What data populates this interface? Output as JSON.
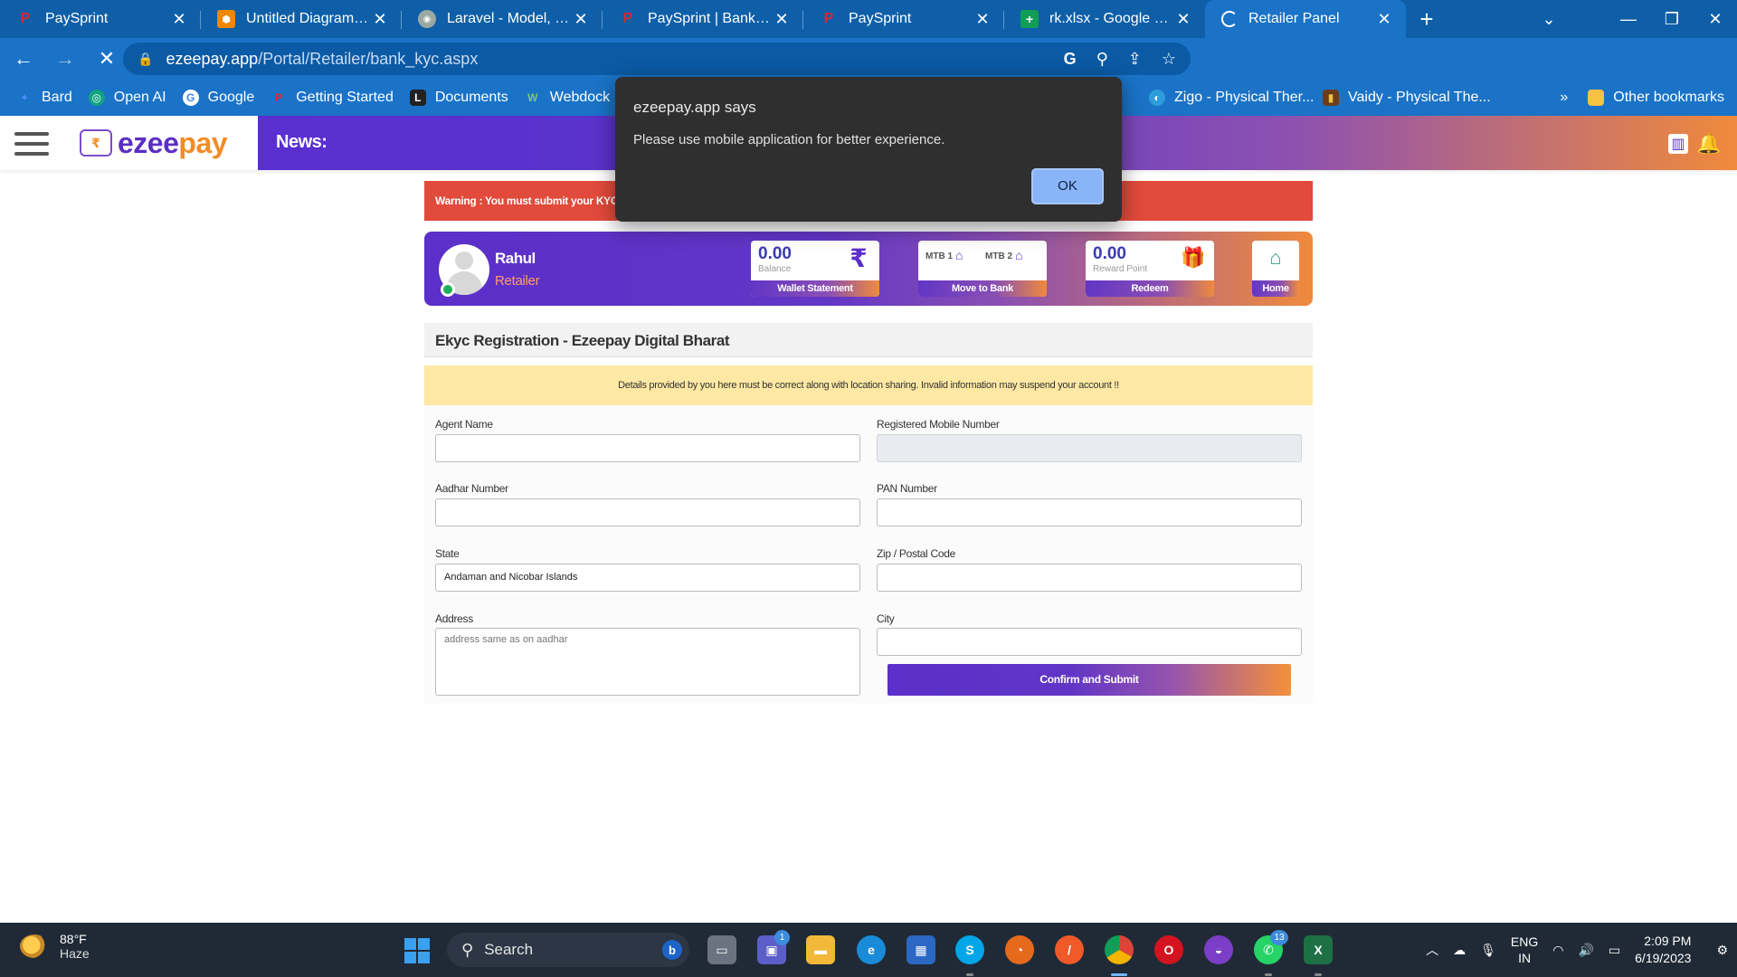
{
  "browser": {
    "tabs": [
      {
        "title": "PaySprint",
        "icon": "paysprint-icon",
        "color": "#e0232e"
      },
      {
        "title": "Untitled Diagram - draw.io",
        "icon": "drawio-icon",
        "color": "#f08705"
      },
      {
        "title": "Laravel - Model, Controller",
        "icon": "laravel-icon",
        "color": "#9aa9a1"
      },
      {
        "title": "PaySprint | Banking, Fintech",
        "icon": "paysprint-icon",
        "color": "#e0232e"
      },
      {
        "title": "PaySprint",
        "icon": "paysprint-icon",
        "color": "#e0232e"
      },
      {
        "title": "rk.xlsx - Google Sheets",
        "icon": "sheets-icon",
        "color": "#0f9d58"
      },
      {
        "title": "Retailer Panel",
        "icon": "loading-icon",
        "color": "#ffffff"
      }
    ],
    "url_host": "ezeepay.app",
    "url_path": "/Portal/Retailer/bank_kyc.aspx",
    "bookmarks": [
      {
        "label": "Bard",
        "color": "#4c8df6"
      },
      {
        "label": "Open AI",
        "color": "#10a37f"
      },
      {
        "label": "Google",
        "color": "#ffffff"
      },
      {
        "label": "Getting Started",
        "color": "#e0232e"
      },
      {
        "label": "Documents",
        "color": "#222222"
      },
      {
        "label": "Webdock :",
        "color": "#7bc96f"
      }
    ],
    "bookmarks_right": [
      {
        "label": "...",
        "color": "#1a73c7"
      },
      {
        "label": "Zigo - Physical Ther...",
        "color": "#2d9cdb"
      },
      {
        "label": "Vaidy - Physical The...",
        "color": "#6b3e1b"
      }
    ],
    "bookmarks_overflow": "»",
    "other_bookmarks": "Other bookmarks"
  },
  "site": {
    "logo_prefix": "ezee",
    "logo_suffix": "pay",
    "logo_mark": "₹",
    "news_label": "News:"
  },
  "warning": "Warning : You must submit your KYC to",
  "profile": {
    "name": "Rahul",
    "role": "Retailer",
    "wallet": {
      "value": "0.00",
      "sub": "Balance",
      "footer": "Wallet Statement"
    },
    "mtb": {
      "mtb1": "MTB 1",
      "mtb2": "MTB 2",
      "footer": "Move to Bank"
    },
    "reward": {
      "value": "0.00",
      "sub": "Reward Point",
      "footer": "Redeem"
    },
    "home": {
      "footer": "Home"
    }
  },
  "section_title": "Ekyc Registration - Ezeepay Digital Bharat",
  "notice": "Details provided by you here must be correct along with location sharing. Invalid information may suspend your account !!",
  "form": {
    "agent_name": {
      "label": "Agent Name",
      "value": ""
    },
    "mobile": {
      "label": "Registered Mobile Number",
      "value": ""
    },
    "aadhar": {
      "label": "Aadhar Number",
      "value": ""
    },
    "pan": {
      "label": "PAN Number",
      "value": ""
    },
    "state": {
      "label": "State",
      "value": "Andaman and Nicobar Islands"
    },
    "zip": {
      "label": "Zip / Postal Code",
      "value": ""
    },
    "address": {
      "label": "Address",
      "placeholder": "address same as on aadhar"
    },
    "city": {
      "label": "City",
      "value": ""
    },
    "submit_label": "Confirm and Submit"
  },
  "dialog": {
    "title": "ezeepay.app says",
    "message": "Please use mobile application for better experience.",
    "ok_label": "OK"
  },
  "taskbar": {
    "temperature": "88°F",
    "weather": "Haze",
    "search_label": "Search",
    "teams_badge": "1",
    "whatsapp_badge": "13",
    "lang_top": "ENG",
    "lang_bottom": "IN",
    "time": "2:09 PM",
    "date": "6/19/2023"
  }
}
